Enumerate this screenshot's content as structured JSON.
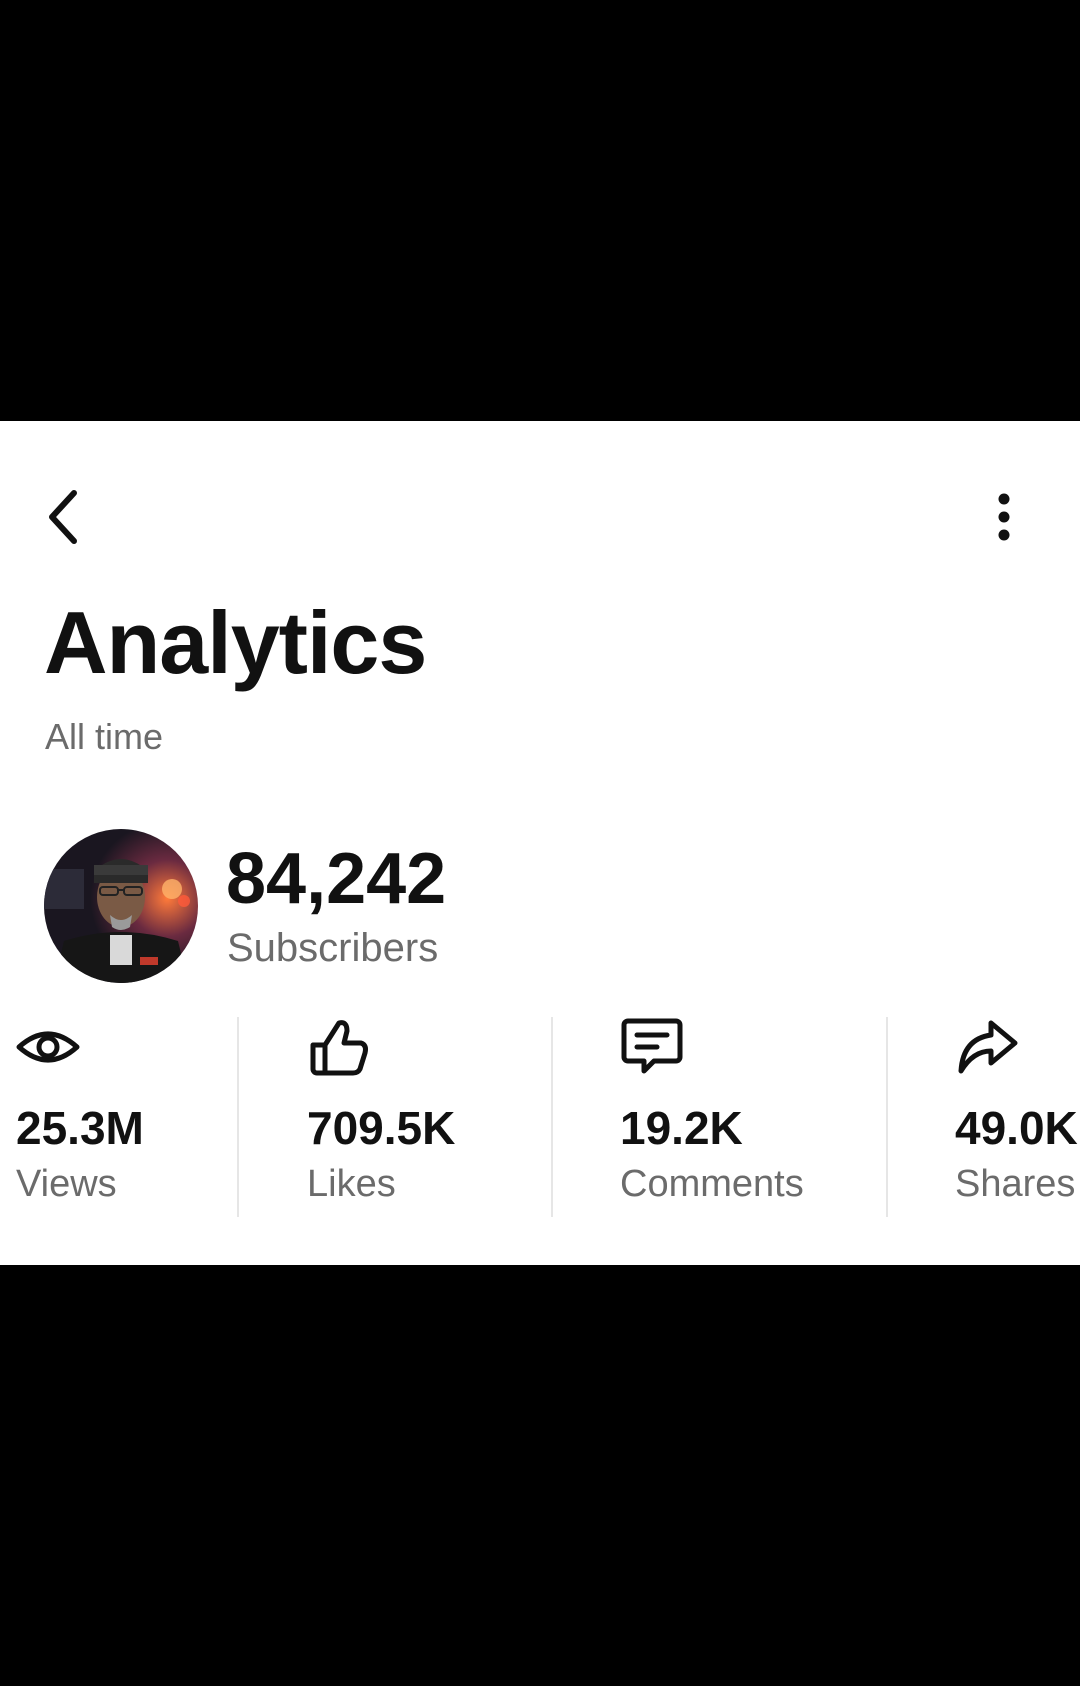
{
  "header": {
    "title": "Analytics",
    "subtitle": "All time",
    "back_icon": "chevron-left-icon",
    "menu_icon": "more-vertical-icon"
  },
  "profile": {
    "subscriber_count": "84,242",
    "subscriber_label": "Subscribers"
  },
  "stats": [
    {
      "icon": "eye-icon",
      "value": "25.3M",
      "label": "Views"
    },
    {
      "icon": "thumbs-up-icon",
      "value": "709.5K",
      "label": "Likes"
    },
    {
      "icon": "comment-icon",
      "value": "19.2K",
      "label": "Comments"
    },
    {
      "icon": "share-icon",
      "value": "49.0K",
      "label": "Shares"
    }
  ],
  "colors": {
    "background": "#ffffff",
    "letterbox": "#000000",
    "primary_text": "#111111",
    "secondary_text": "#6b6b6b",
    "divider": "#e6e6e6"
  }
}
